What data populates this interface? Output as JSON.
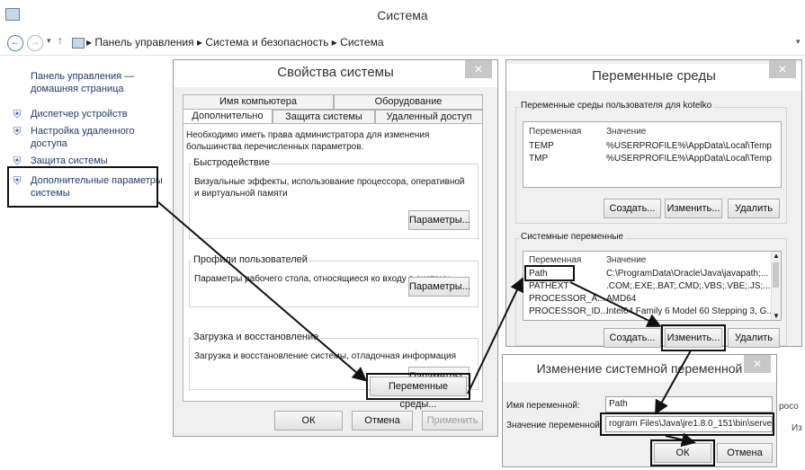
{
  "window": {
    "title": "Система"
  },
  "address": {
    "items": [
      "Панель управления",
      "Система и безопасность",
      "Система"
    ],
    "separator": "▸"
  },
  "left_pane": {
    "home": "Панель управления —\nдомашняя страница",
    "links": [
      "Диспетчер устройств",
      "Настройка удаленного\nдоступа",
      "Защита системы",
      "Дополнительные параметры\nсистемы"
    ]
  },
  "sys_props": {
    "title": "Свойства системы",
    "tabs_top": [
      "Имя компьютера",
      "Оборудование"
    ],
    "tabs_bottom": [
      "Дополнительно",
      "Защита системы",
      "Удаленный доступ"
    ],
    "admin_note": "Необходимо иметь права администратора для изменения большинства перечисленных параметров.",
    "perf_label": "Быстродействие",
    "perf_text": "Визуальные эффекты, использование процессора, оперативной и виртуальной памяти",
    "params": "Параметры...",
    "profiles_label": "Профили пользователей",
    "profiles_text": "Параметры рабочего стола, относящиеся ко входу в систему",
    "boot_label": "Загрузка и восстановление",
    "boot_text": "Загрузка и восстановление системы, отладочная информация",
    "env_button": "Переменные среды...",
    "ok": "ОК",
    "cancel": "Отмена",
    "apply": "Применить"
  },
  "env_vars": {
    "title": "Переменные среды",
    "user_group": "Переменные среды пользователя для kotelko",
    "col_var": "Переменная",
    "col_val": "Значение",
    "user_rows": [
      {
        "name": "TEMP",
        "value": "%USERPROFILE%\\AppData\\Local\\Temp"
      },
      {
        "name": "TMP",
        "value": "%USERPROFILE%\\AppData\\Local\\Temp"
      }
    ],
    "create": "Создать...",
    "edit": "Изменить...",
    "delete": "Удалить",
    "sys_group": "Системные переменные",
    "sys_rows": [
      {
        "name": "Path",
        "value": "C:\\ProgramData\\Oracle\\Java\\javapath;..."
      },
      {
        "name": "PATHEXT",
        "value": ".COM;.EXE;.BAT;.CMD;.VBS;.VBE;.JS;...."
      },
      {
        "name": "PROCESSOR_A...",
        "value": "AMD64"
      },
      {
        "name": "PROCESSOR_ID...",
        "value": "Intel64 Family 6 Model 60 Stepping 3, G..."
      }
    ]
  },
  "edit_var": {
    "title": "Изменение системной переменной",
    "name_label": "Имя переменной:",
    "name_value": "Path",
    "value_label": "Значение переменной:",
    "value_value": "rogram Files\\Java\\jre1.8.0_151\\bin\\server",
    "ok": "ОК",
    "cancel": "Отмена"
  },
  "edge_text": {
    "right_1": "росо",
    "right_2": "Из"
  }
}
